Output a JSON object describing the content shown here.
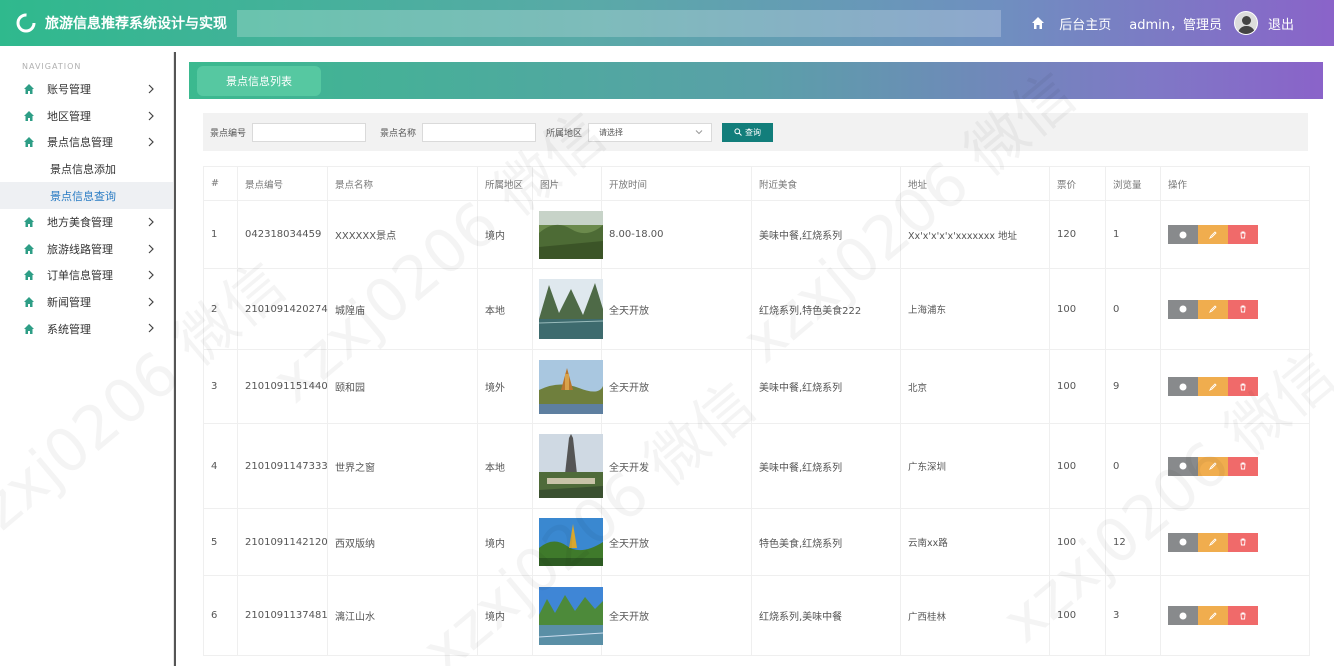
{
  "header": {
    "title": "旅游信息推荐系统设计与实现",
    "home_label": "后台主页",
    "user_label": "admin，管理员",
    "logout_label": "退出"
  },
  "sidebar": {
    "heading": "NAVIGATION",
    "items": [
      {
        "label": "账号管理"
      },
      {
        "label": "地区管理"
      },
      {
        "label": "景点信息管理"
      },
      {
        "label": "地方美食管理"
      },
      {
        "label": "旅游线路管理"
      },
      {
        "label": "订单信息管理"
      },
      {
        "label": "新闻管理"
      },
      {
        "label": "系统管理"
      }
    ],
    "subitems": [
      {
        "label": "景点信息添加"
      },
      {
        "label": "景点信息查询"
      }
    ]
  },
  "panel": {
    "title": "景点信息列表"
  },
  "search": {
    "code_label": "景点编号",
    "name_label": "景点名称",
    "region_label": "所属地区",
    "region_selected": "请选择",
    "button_label": "查询"
  },
  "table": {
    "headers": [
      "#",
      "景点编号",
      "景点名称",
      "所属地区",
      "图片",
      "开放时间",
      "附近美食",
      "地址",
      "票价",
      "浏览量",
      "操作"
    ],
    "rows": [
      {
        "no": "1",
        "code": "042318034459",
        "name": "XXXXXX景点",
        "region": "境内",
        "open": "8.00-18.00",
        "food": "美味中餐,红烧系列",
        "addr": "Xx'x'x'x'x'xxxxxxx 地址",
        "price": "120",
        "views": "1"
      },
      {
        "no": "2",
        "code": "2101091420274",
        "name": "城隍庙",
        "region": "本地",
        "open": "全天开放",
        "food": "红烧系列,特色美食222",
        "addr": "上海浦东",
        "price": "100",
        "views": "0"
      },
      {
        "no": "3",
        "code": "2101091151440",
        "name": "颐和园",
        "region": "境外",
        "open": "全天开放",
        "food": "美味中餐,红烧系列",
        "addr": "北京",
        "price": "100",
        "views": "9"
      },
      {
        "no": "4",
        "code": "2101091147333",
        "name": "世界之窗",
        "region": "本地",
        "open": "全天开发",
        "food": "美味中餐,红烧系列",
        "addr": "广东深圳",
        "price": "100",
        "views": "0"
      },
      {
        "no": "5",
        "code": "2101091142120",
        "name": "西双版纳",
        "region": "境内",
        "open": "全天开放",
        "food": "特色美食,红烧系列",
        "addr": "云南xx路",
        "price": "100",
        "views": "12"
      },
      {
        "no": "6",
        "code": "2101091137481",
        "name": "漓江山水",
        "region": "境内",
        "open": "全天开放",
        "food": "红烧系列,美味中餐",
        "addr": "广西桂林",
        "price": "100",
        "views": "3"
      }
    ]
  },
  "watermark": "xzxj0206 微信",
  "colors": {
    "header_start": "#2fb98d",
    "header_end": "#8a63c9",
    "search_button": "#127e7b",
    "view_button": "#888a8c",
    "edit_button": "#f0ad4e",
    "delete_button": "#f06a6a",
    "active_sub": "#2a7cc4"
  }
}
